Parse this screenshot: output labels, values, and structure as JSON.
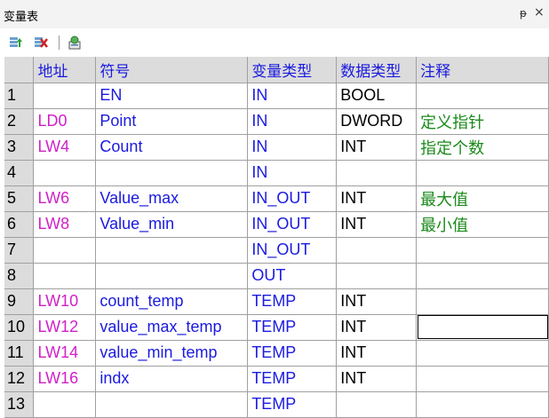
{
  "window": {
    "title": "变量表",
    "pin_glyph": "ᵽ",
    "close_glyph": "×"
  },
  "columns": {
    "num": "",
    "addr": "地址",
    "sym": "符号",
    "vtype": "变量类型",
    "dtype": "数据类型",
    "cmt": "注释"
  },
  "rows": [
    {
      "num": "1",
      "addr": "",
      "sym": "EN",
      "vtype": "IN",
      "dtype": "BOOL",
      "cmt": ""
    },
    {
      "num": "2",
      "addr": "LD0",
      "sym": "Point",
      "vtype": "IN",
      "dtype": "DWORD",
      "cmt": "定义指针"
    },
    {
      "num": "3",
      "addr": "LW4",
      "sym": "Count",
      "vtype": "IN",
      "dtype": "INT",
      "cmt": "指定个数"
    },
    {
      "num": "4",
      "addr": "",
      "sym": "",
      "vtype": "IN",
      "dtype": "",
      "cmt": ""
    },
    {
      "num": "5",
      "addr": "LW6",
      "sym": "Value_max",
      "vtype": "IN_OUT",
      "dtype": "INT",
      "cmt": "最大值"
    },
    {
      "num": "6",
      "addr": "LW8",
      "sym": "Value_min",
      "vtype": "IN_OUT",
      "dtype": "INT",
      "cmt": "最小值"
    },
    {
      "num": "7",
      "addr": "",
      "sym": "",
      "vtype": "IN_OUT",
      "dtype": "",
      "cmt": ""
    },
    {
      "num": "8",
      "addr": "",
      "sym": "",
      "vtype": "OUT",
      "dtype": "",
      "cmt": ""
    },
    {
      "num": "9",
      "addr": "LW10",
      "sym": "count_temp",
      "vtype": "TEMP",
      "dtype": "INT",
      "cmt": ""
    },
    {
      "num": "10",
      "addr": "LW12",
      "sym": "value_max_temp",
      "vtype": "TEMP",
      "dtype": "INT",
      "cmt": ""
    },
    {
      "num": "11",
      "addr": "LW14",
      "sym": "value_min_temp",
      "vtype": "TEMP",
      "dtype": "INT",
      "cmt": ""
    },
    {
      "num": "12",
      "addr": "LW16",
      "sym": "indx",
      "vtype": "TEMP",
      "dtype": "INT",
      "cmt": ""
    },
    {
      "num": "13",
      "addr": "",
      "sym": "",
      "vtype": "TEMP",
      "dtype": "",
      "cmt": ""
    }
  ],
  "selected_comment_row": 9,
  "toolbar": {
    "icons": [
      "insert-row-icon",
      "delete-row-icon",
      "properties-icon"
    ]
  },
  "colors": {
    "address": "#d020c8",
    "symbol": "#1a1ae0",
    "comment": "#1a8a1a",
    "header_bg": "#dcdcdc"
  }
}
